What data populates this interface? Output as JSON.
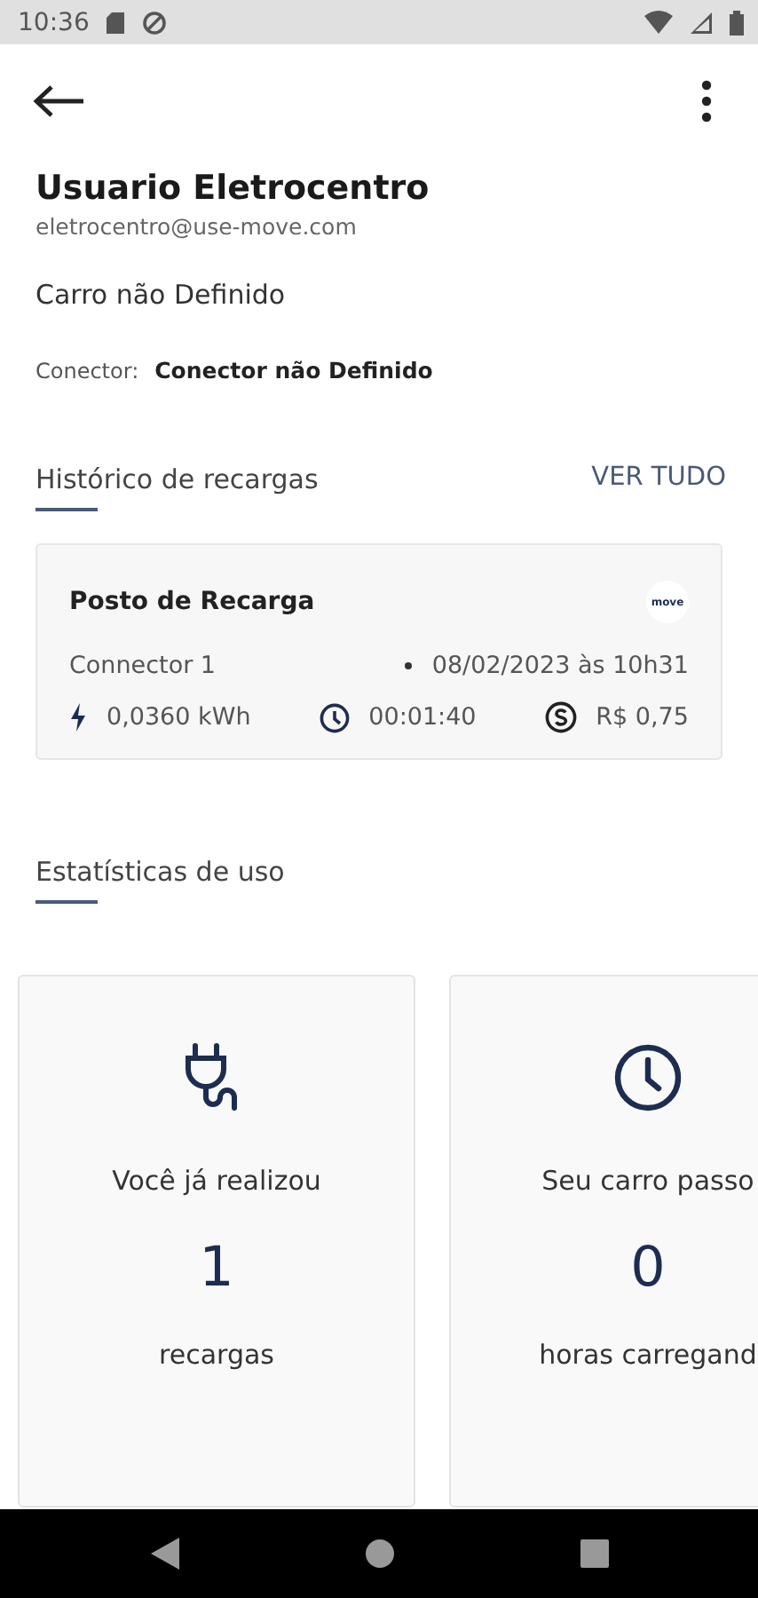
{
  "status_bar": {
    "time": "10:36"
  },
  "profile": {
    "name": "Usuario Eletrocentro",
    "email": "eletrocentro@use-move.com",
    "car": "Carro não Definido",
    "connector_label": "Conector:",
    "connector_value": "Conector não Definido"
  },
  "history": {
    "title": "Histórico de recargas",
    "action": "VER TUDO",
    "records": [
      {
        "station": "Posto de Recarga",
        "logo": "move",
        "connector": "Connector 1",
        "date": "08/02/2023 às 10h31",
        "energy": "0,0360 kWh",
        "duration": "00:01:40",
        "cost": "R$ 0,75"
      }
    ]
  },
  "stats": {
    "title": "Estatísticas de uso",
    "cards": [
      {
        "kind": "plug",
        "label": "Você já realizou",
        "value": "1",
        "unit": "recargas"
      },
      {
        "kind": "clock",
        "label": "Seu carro passo",
        "value": "0",
        "unit": "horas carregand"
      }
    ]
  }
}
